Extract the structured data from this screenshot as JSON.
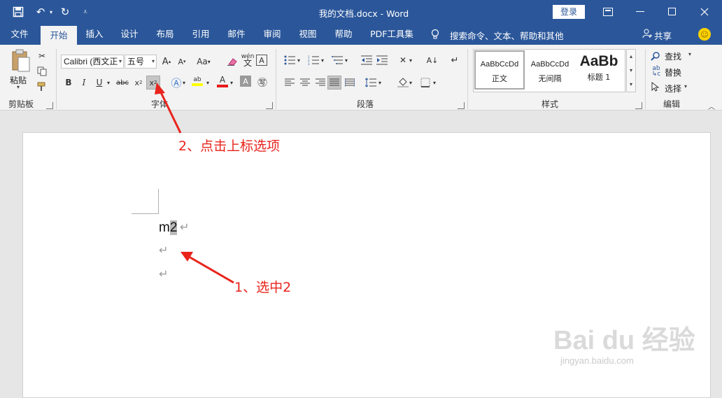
{
  "titlebar": {
    "document_title": "我的文档.docx  -  Word",
    "login_label": "登录",
    "bg_color": "#2b579a"
  },
  "menu": {
    "tabs": [
      "文件",
      "开始",
      "插入",
      "设计",
      "布局",
      "引用",
      "邮件",
      "审阅",
      "视图",
      "帮助",
      "PDF工具集"
    ],
    "active_tab": "开始",
    "search_hint": "搜索命令、文本、帮助和其他",
    "share_label": "共享"
  },
  "ribbon": {
    "clipboard": {
      "paste_label": "粘贴",
      "group_label": "剪贴板"
    },
    "font": {
      "font_name": "Calibri (西文正",
      "font_size": "五号",
      "case_label": "Aa",
      "wen_label": "wén",
      "group_label": "字体"
    },
    "paragraph": {
      "group_label": "段落"
    },
    "styles": {
      "items": [
        {
          "preview": "AaBbCcDd",
          "name": "正文"
        },
        {
          "preview": "AaBbCcDd",
          "name": "无间隔"
        },
        {
          "preview": "AaBb",
          "name": "标题 1"
        }
      ],
      "group_label": "样式"
    },
    "editing": {
      "find_label": "查找",
      "replace_label": "替换",
      "select_label": "选择",
      "group_label": "编辑"
    }
  },
  "document": {
    "text_base": "m",
    "text_selected": "2"
  },
  "annotations": {
    "step2": "2、点击上标选项",
    "step1": "1、选中2",
    "color": "#e8241c"
  },
  "watermark": {
    "brand": "Bai du 经验",
    "url": "jingyan.baidu.com"
  }
}
